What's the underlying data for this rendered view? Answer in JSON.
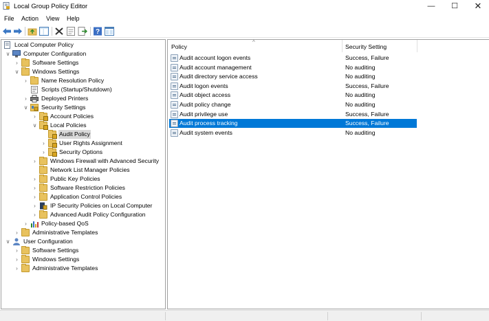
{
  "window": {
    "title": "Local Group Policy Editor",
    "min_glyph": "—",
    "max_glyph": "☐",
    "close_glyph": "✕"
  },
  "menu": [
    "File",
    "Action",
    "View",
    "Help"
  ],
  "toolbar": [
    "back-icon",
    "forward-icon",
    "up-folder-icon",
    "show-hide-tree-icon",
    "delete-icon",
    "properties-icon",
    "export-list-icon",
    "help-icon",
    "console-view-icon"
  ],
  "tree": {
    "items": [
      {
        "label": "Local Computer Policy",
        "icon": "policy-doc-icon",
        "level": 0,
        "twisty": ""
      },
      {
        "label": "Computer Configuration",
        "icon": "computer-icon",
        "level": 1,
        "twisty": "open"
      },
      {
        "label": "Software Settings",
        "icon": "folder-icon",
        "level": 2,
        "twisty": "closed"
      },
      {
        "label": "Windows Settings",
        "icon": "folder-icon",
        "level": 2,
        "twisty": "open"
      },
      {
        "label": "Name Resolution Policy",
        "icon": "folder-icon",
        "level": 3,
        "twisty": "closed"
      },
      {
        "label": "Scripts (Startup/Shutdown)",
        "icon": "scripts-icon",
        "level": 3,
        "twisty": ""
      },
      {
        "label": "Deployed Printers",
        "icon": "printer-icon",
        "level": 3,
        "twisty": "closed"
      },
      {
        "label": "Security Settings",
        "icon": "security-icon",
        "level": 3,
        "twisty": "open"
      },
      {
        "label": "Account Policies",
        "icon": "lock-folder-icon",
        "level": 4,
        "twisty": "closed"
      },
      {
        "label": "Local Policies",
        "icon": "lock-folder-icon",
        "level": 4,
        "twisty": "open"
      },
      {
        "label": "Audit Policy",
        "icon": "lock-folder-icon",
        "level": 5,
        "twisty": "",
        "selected": true
      },
      {
        "label": "User Rights Assignment",
        "icon": "lock-folder-icon",
        "level": 5,
        "twisty": "closed"
      },
      {
        "label": "Security Options",
        "icon": "lock-folder-icon",
        "level": 5,
        "twisty": "closed"
      },
      {
        "label": "Windows Firewall with Advanced Security",
        "icon": "folder-icon",
        "level": 4,
        "twisty": "closed"
      },
      {
        "label": "Network List Manager Policies",
        "icon": "folder-icon",
        "level": 4,
        "twisty": ""
      },
      {
        "label": "Public Key Policies",
        "icon": "folder-icon",
        "level": 4,
        "twisty": "closed"
      },
      {
        "label": "Software Restriction Policies",
        "icon": "folder-icon",
        "level": 4,
        "twisty": "closed"
      },
      {
        "label": "Application Control Policies",
        "icon": "folder-icon",
        "level": 4,
        "twisty": "closed"
      },
      {
        "label": "IP Security Policies on Local Computer",
        "icon": "ipsec-icon",
        "level": 4,
        "twisty": "closed"
      },
      {
        "label": "Advanced Audit Policy Configuration",
        "icon": "folder-icon",
        "level": 4,
        "twisty": "closed"
      },
      {
        "label": "Policy-based QoS",
        "icon": "qos-chart-icon",
        "level": 3,
        "twisty": "closed"
      },
      {
        "label": "Administrative Templates",
        "icon": "folder-icon",
        "level": 2,
        "twisty": "closed"
      },
      {
        "label": "User Configuration",
        "icon": "user-icon",
        "level": 1,
        "twisty": "open"
      },
      {
        "label": "Software Settings",
        "icon": "folder-icon",
        "level": 2,
        "twisty": "closed"
      },
      {
        "label": "Windows Settings",
        "icon": "folder-icon",
        "level": 2,
        "twisty": "closed"
      },
      {
        "label": "Administrative Templates",
        "icon": "folder-icon",
        "level": 2,
        "twisty": "closed"
      }
    ]
  },
  "list": {
    "columns": [
      "Policy",
      "Security Setting"
    ],
    "sort_glyph": "^",
    "rows": [
      {
        "policy": "Audit account logon events",
        "setting": "Success, Failure"
      },
      {
        "policy": "Audit account management",
        "setting": "No auditing"
      },
      {
        "policy": "Audit directory service access",
        "setting": "No auditing"
      },
      {
        "policy": "Audit logon events",
        "setting": "Success, Failure"
      },
      {
        "policy": "Audit object access",
        "setting": "No auditing"
      },
      {
        "policy": "Audit policy change",
        "setting": "No auditing"
      },
      {
        "policy": "Audit privilege use",
        "setting": "Success, Failure"
      },
      {
        "policy": "Audit process tracking",
        "setting": "Success, Failure",
        "selected": true
      },
      {
        "policy": "Audit system events",
        "setting": "No auditing"
      }
    ]
  },
  "colors": {
    "selection": "#0078d7",
    "tree_selection": "#d9d9d9",
    "folder": "#e8c25e"
  }
}
